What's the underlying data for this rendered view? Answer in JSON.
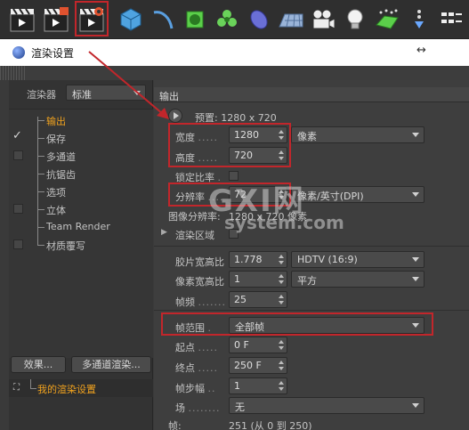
{
  "toolbar": {
    "icons": [
      "render-view-icon",
      "render-picture-viewer-icon",
      "render-settings-icon",
      "cube-icon",
      "spline-icon",
      "deformer-icon",
      "mograph-icon",
      "generator-icon",
      "floor-icon",
      "camera-icon",
      "light-icon",
      "tags-icon",
      "sort-icon",
      "more-icon"
    ]
  },
  "window": {
    "title": "渲染设置",
    "move_glyph": "↔"
  },
  "renderer": {
    "label": "渲染器",
    "value": "标准"
  },
  "tree": [
    {
      "label": "输出",
      "checked": false,
      "has_checkbox": false,
      "active": true
    },
    {
      "label": "保存",
      "checked": true,
      "has_checkbox": true,
      "active": false
    },
    {
      "label": "多通道",
      "checked": false,
      "has_checkbox": true,
      "active": false
    },
    {
      "label": "抗锯齿",
      "checked": false,
      "has_checkbox": false,
      "active": false
    },
    {
      "label": "选项",
      "checked": false,
      "has_checkbox": false,
      "active": false
    },
    {
      "label": "立体",
      "checked": false,
      "has_checkbox": true,
      "active": false
    },
    {
      "label": "Team Render",
      "checked": false,
      "has_checkbox": false,
      "active": false
    },
    {
      "label": "材质覆写",
      "checked": false,
      "has_checkbox": true,
      "active": false
    }
  ],
  "buttons": {
    "effects": "效果...",
    "multipass_render": "多通道渲染..."
  },
  "my_settings": "我的渲染设置",
  "output": {
    "section_title": "输出",
    "preset": "预置: 1280 x 720",
    "width_label": "宽度",
    "width_value": "1280",
    "height_label": "高度",
    "height_value": "720",
    "unit": "像素",
    "lock_ratio_label": "锁定比率",
    "resolution_label": "分辨率",
    "resolution_value": "72",
    "resolution_unit": "像素/英寸(DPI)",
    "image_resolution_label": "图像分辨率:",
    "image_resolution_value": "1280 x 720 像素",
    "render_region_label": "渲染区域",
    "film_aspect_label": "胶片宽高比",
    "film_aspect_value": "1.778",
    "film_aspect_preset": "HDTV (16:9)",
    "pixel_aspect_label": "像素宽高比",
    "pixel_aspect_value": "1",
    "pixel_aspect_preset": "平方",
    "fps_label": "帧频",
    "fps_value": "25",
    "frame_range_label": "帧范围",
    "frame_range_value": "全部帧",
    "start_label": "起点",
    "start_value": "0 F",
    "end_label": "终点",
    "end_value": "250 F",
    "step_label": "帧步幅",
    "step_value": "1",
    "field_label": "场",
    "field_value": "无",
    "frames_label": "帧:",
    "frames_value": "251 (从 0 到 250)"
  },
  "watermark": {
    "big": "GXI网",
    "small": "system.com"
  },
  "colors": {
    "highlight": "#c2262b",
    "active": "#f0a21e",
    "panel": "#3e3e3e"
  }
}
